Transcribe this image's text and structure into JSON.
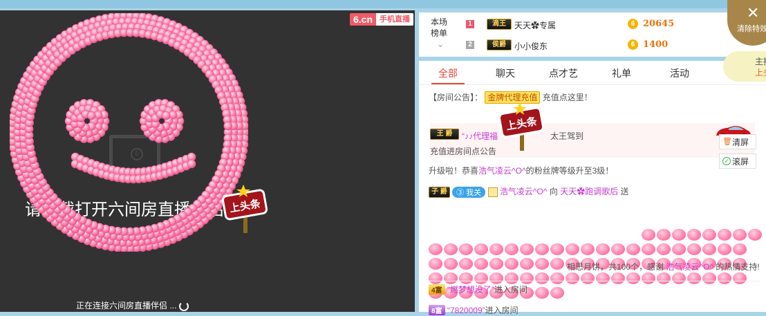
{
  "video": {
    "brand_main": "6.cn",
    "brand_sub": "手机直播",
    "hint_text": "请下载打开六间房直播伴侣",
    "connecting_text": "正在连接六间房直播伴侣 ...",
    "sign_text": "上头条"
  },
  "rank": {
    "label": "本场榜单",
    "rows": [
      {
        "num": "1",
        "num_color": "#f0566a",
        "level": "滴王",
        "name": "天天✿专属",
        "score": "20645"
      },
      {
        "num": "2",
        "num_color": "#a8a8a8",
        "level": "侯爵",
        "name": "小小俊东",
        "score": "1400"
      }
    ],
    "coin_glyph": "6"
  },
  "overlay": {
    "clear_effect_label": "清除特效",
    "headline_line1": "主播",
    "headline_line2": "上头"
  },
  "tabs": [
    "全部",
    "聊天",
    "点才艺",
    "礼单",
    "活动"
  ],
  "chat": {
    "announce_prefix": "【房间公告】：",
    "announce_tag": "金牌代理充值",
    "announce_suffix": "充值点这里！",
    "vip_level": "王 爵",
    "vip_name": "“♪♪代理福",
    "vip_tail": "太王驾到",
    "vip_sub": "充值进房间点公告",
    "vip_sign": "上头条",
    "levelup_prefix": "升级啦！恭喜",
    "levelup_name": "浩气凌云^O^",
    "levelup_suffix": "的粉丝牌等级升至3级！",
    "gift_level": "子 爵",
    "gift_fan_badge": "③ 我关",
    "gift_sender": "浩气凌云^O^",
    "gift_to": "向",
    "gift_receiver": "天天✿跑调歌后",
    "gift_send": "送",
    "gift_summary_prefix": "相思月饼，共100个，感谢",
    "gift_summary_name": "浩气凌云^O^",
    "gift_summary_suffix": "的热情支持!",
    "enter1_level": "4富",
    "enter1_name": "“燃梦想没了”",
    "enter1_action": "进入房间",
    "enter2_level": "8富",
    "enter2_name": "“7820009”",
    "enter2_action": "进入房间"
  },
  "side_buttons": {
    "clear_screen": "清屏",
    "scroll_screen": "滚屏"
  },
  "colors": {
    "accent": "#e84535",
    "bg_top": "#a9d3e8",
    "gift_pink": "#ff7fab"
  }
}
